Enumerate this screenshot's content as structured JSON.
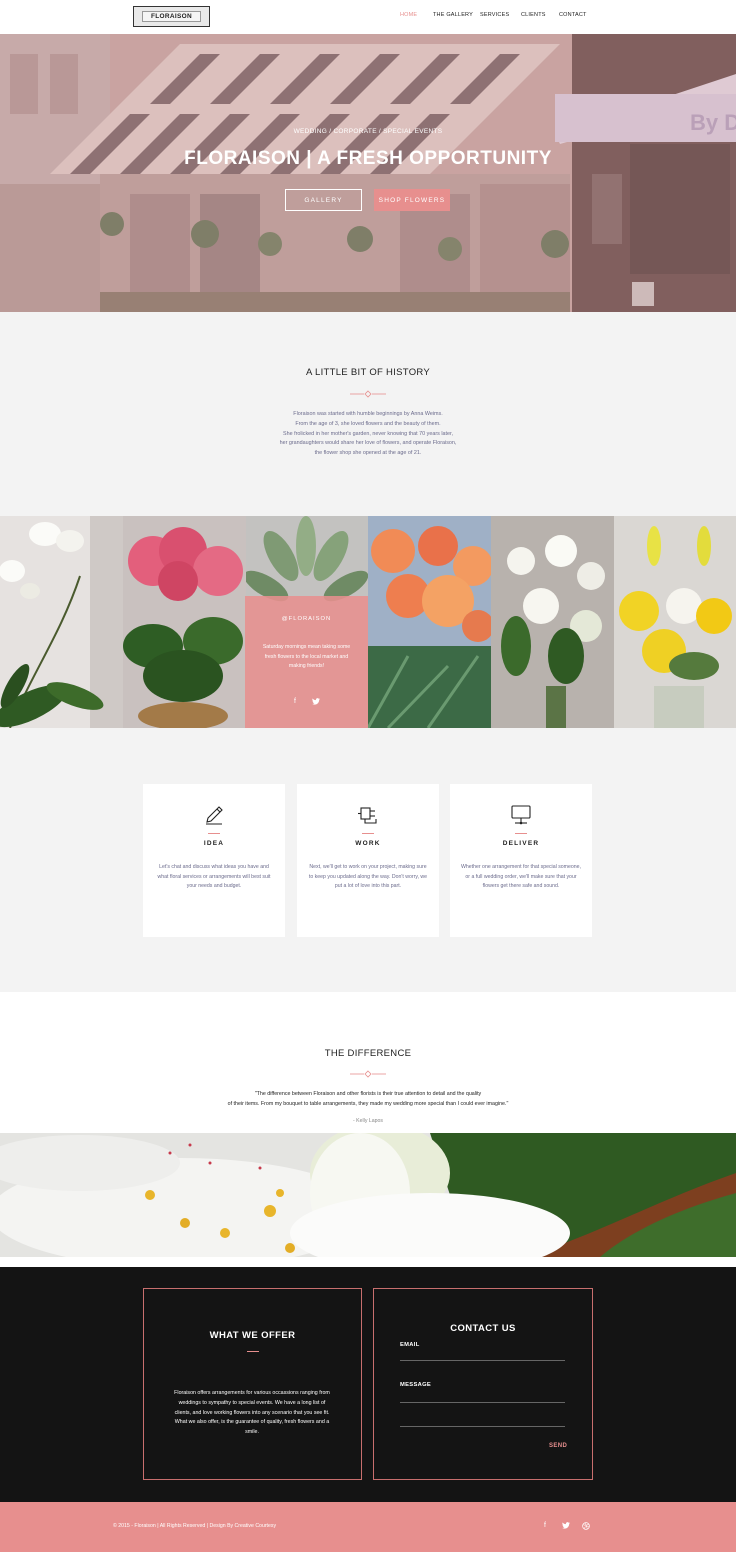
{
  "nav": {
    "logo": "FLORAISON",
    "items": [
      {
        "label": "HOME",
        "active": true
      },
      {
        "label": "THE GALLERY",
        "active": false
      },
      {
        "label": "SERVICES",
        "active": false
      },
      {
        "label": "CLIENTS",
        "active": false
      },
      {
        "label": "CONTACT",
        "active": false
      }
    ]
  },
  "hero": {
    "tagline": "WEDDING / CORPORATE / SPECIAL EVENTS",
    "title": "FLORAISON | A FRESH OPPORTUNITY",
    "gallery_button": "GALLERY",
    "shop_button": "SHOP FLOWERS"
  },
  "history": {
    "title": "A LITTLE BIT OF HISTORY",
    "lines": [
      "Floraison was started with humble beginnings by Anna Weims.",
      "From the age of 3, she loved flowers and the beauty of them.",
      "She frolicked in her mother's garden, never knowing that 70 years later,",
      "her grandaughters would share her love of flowers, and operate Floraison,",
      "the flower shop she opened at the age of 21."
    ]
  },
  "social_card": {
    "handle": "@FLORAISON",
    "text": "Saturday mornings mean taking some fresh flowers to the local market and making friends!",
    "icons": [
      "facebook-icon",
      "twitter-icon"
    ]
  },
  "process": [
    {
      "title": "IDEA",
      "icon": "pencil-icon",
      "text": "Let's chat and discuss what ideas you have and what floral services or arrangements will best suit your needs and budget."
    },
    {
      "title": "WORK",
      "icon": "plug-icon",
      "text": "Next, we'll get to work on your project, making sure to keep you updated along the way. Don't worry, we put a lot of love into this part."
    },
    {
      "title": "DELIVER",
      "icon": "monitor-icon",
      "text": "Whether one arrangement for that special someone, or a full wedding order, we'll make sure that your flowers get there safe and sound."
    }
  ],
  "difference": {
    "title": "THE DIFFERENCE",
    "quote_line1": "\"The difference between Floraison and other florists is their true attention to detail and the quality",
    "quote_line2": "of their items. From my bouquet to table arrangements, they made my wedding more special than I could ever imagine.\"",
    "author": "- Kelly Lapos"
  },
  "offer": {
    "title": "WHAT WE OFFER",
    "text": "Floraison offers arrangements for various occassions ranging from weddings to sympathy to special events. We have a long list of clients, and love working flowers into any scenario that you see fit. What we also offer, is the guarantee of quality, fresh flowers and a smile."
  },
  "contact": {
    "title": "CONTACT US",
    "email_label": "EMAIL",
    "message_label": "MESSAGE",
    "send": "SEND"
  },
  "footer": {
    "copyright": "© 2015 - Floraison | All Rights Reserved | Design By Creative Courtesy",
    "icons": [
      "facebook-icon",
      "twitter-icon",
      "dribbble-icon"
    ]
  },
  "colors": {
    "accent": "#e78f8e",
    "dark": "#141414",
    "light_gray": "#f3f3f3"
  }
}
